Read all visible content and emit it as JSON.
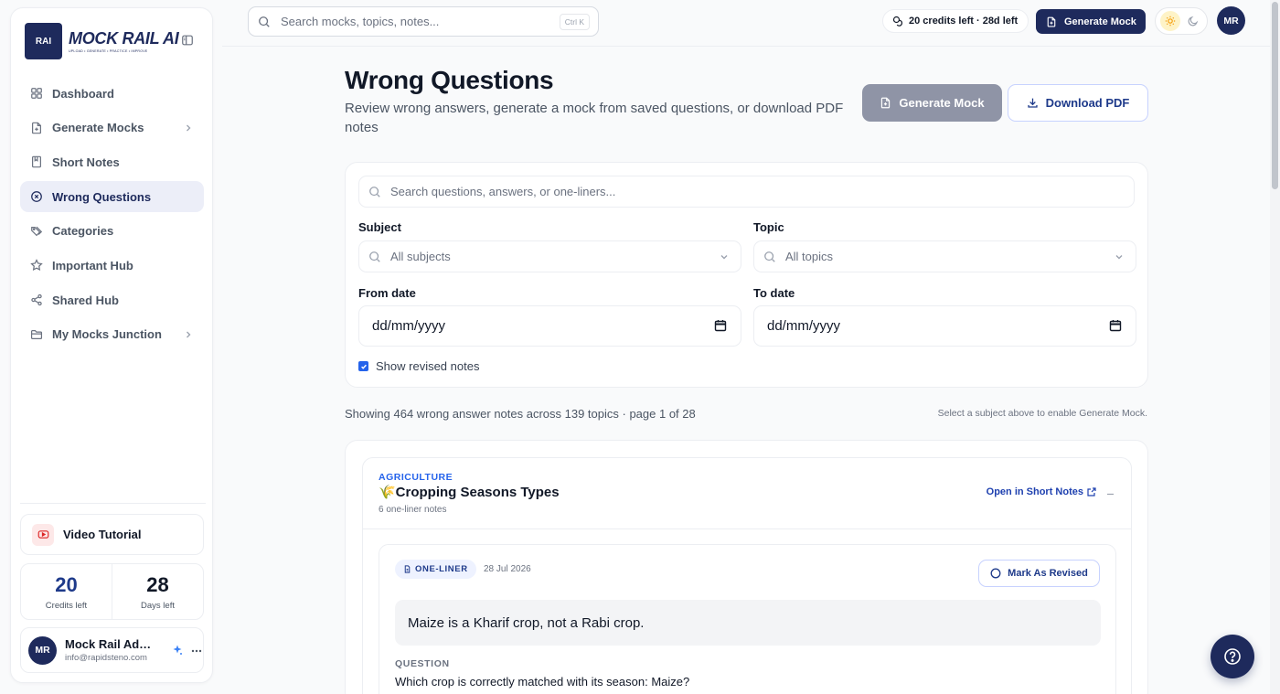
{
  "brand": {
    "logo_badge": "RAI",
    "title": "MOCK RAIL AI",
    "tagline": "UPLOAD • GENERATE • PRACTICE • IMPROVE"
  },
  "sidebar": {
    "items": [
      {
        "label": "Dashboard",
        "icon": "grid-icon"
      },
      {
        "label": "Generate Mocks",
        "icon": "file-plus-icon",
        "has_chevron": true
      },
      {
        "label": "Short Notes",
        "icon": "notebook-icon"
      },
      {
        "label": "Wrong Questions",
        "icon": "x-circle-icon",
        "active": true
      },
      {
        "label": "Categories",
        "icon": "tags-icon"
      },
      {
        "label": "Important Hub",
        "icon": "star-icon"
      },
      {
        "label": "Shared Hub",
        "icon": "share-icon"
      },
      {
        "label": "My Mocks Junction",
        "icon": "folder-icon",
        "has_chevron": true
      }
    ],
    "video_tutorial": "Video Tutorial",
    "stats": [
      {
        "value": "20",
        "label": "Credits left"
      },
      {
        "value": "28",
        "label": "Days left"
      }
    ],
    "user": {
      "initials": "MR",
      "name": "Mock Rail Admin",
      "email": "info@rapidsteno.com"
    }
  },
  "topbar": {
    "search_placeholder": "Search mocks, topics, notes...",
    "shortcut": "Ctrl K",
    "credits": "20 credits left · 28d left",
    "generate_label": "Generate Mock",
    "avatar": "MR"
  },
  "page": {
    "title": "Wrong Questions",
    "subtitle": "Review wrong answers, generate a mock from saved questions, or download PDF notes",
    "generate_button": "Generate Mock",
    "download_button": "Download PDF"
  },
  "filters": {
    "search_placeholder": "Search questions, answers, or one-liners...",
    "subject_label": "Subject",
    "subject_placeholder": "All subjects",
    "topic_label": "Topic",
    "topic_placeholder": "All topics",
    "from_label": "From date",
    "to_label": "To date",
    "date_placeholder": "dd/mm/yyyy",
    "show_revised": "Show revised notes",
    "show_revised_checked": true
  },
  "summary": {
    "showing": "Showing 464 wrong answer notes across 139 topics · page 1 of 28",
    "hint": "Select a subject above to enable Generate Mock."
  },
  "topic_group": {
    "subject": "AGRICULTURE",
    "title": "🌾Cropping Seasons Types",
    "count": "6 one-liner notes",
    "open_link": "Open in Short Notes",
    "note": {
      "badge": "ONE-LINER",
      "date": "28 Jul 2026",
      "mark_label": "Mark As Revised",
      "answer": "Maize is a Kharif crop, not a Rabi crop.",
      "question_label": "QUESTION",
      "question": "Which crop is correctly matched with its season: Maize?"
    }
  },
  "colors": {
    "brand": "#1e2a5c",
    "accent": "#2563eb",
    "active_bg": "#eceef8"
  }
}
